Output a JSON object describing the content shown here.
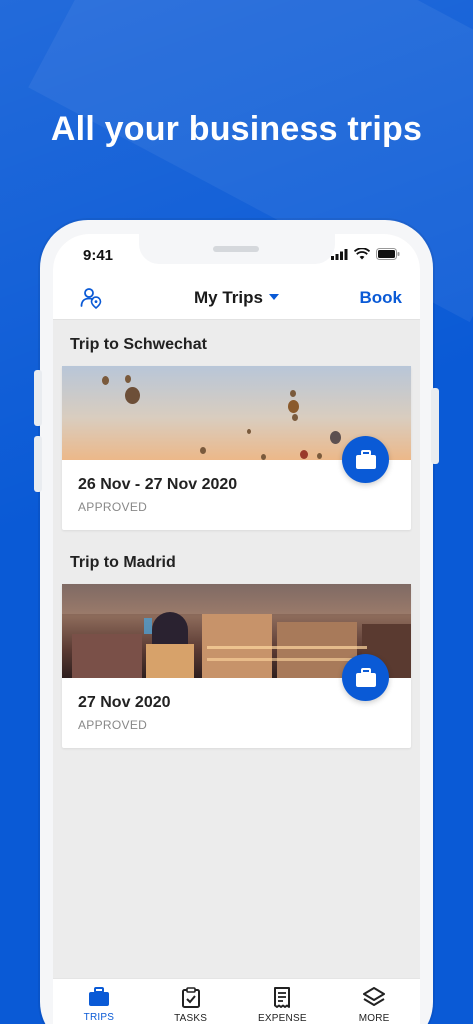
{
  "headline": "All your business trips",
  "status_bar": {
    "time": "9:41"
  },
  "navbar": {
    "title": "My Trips",
    "right_action": "Book"
  },
  "trips": [
    {
      "title": "Trip to Schwechat",
      "dates": "26 Nov - 27 Nov 2020",
      "status": "APPROVED"
    },
    {
      "title": "Trip to Madrid",
      "dates": "27 Nov 2020",
      "status": "APPROVED"
    }
  ],
  "tabs": [
    {
      "label": "TRIPS",
      "icon": "suitcase-icon",
      "active": true
    },
    {
      "label": "TASKS",
      "icon": "checklist-icon",
      "active": false
    },
    {
      "label": "EXPENSE",
      "icon": "receipt-icon",
      "active": false
    },
    {
      "label": "MORE",
      "icon": "layers-icon",
      "active": false
    }
  ],
  "colors": {
    "brand": "#0a5ad6",
    "background": "#ececec"
  }
}
